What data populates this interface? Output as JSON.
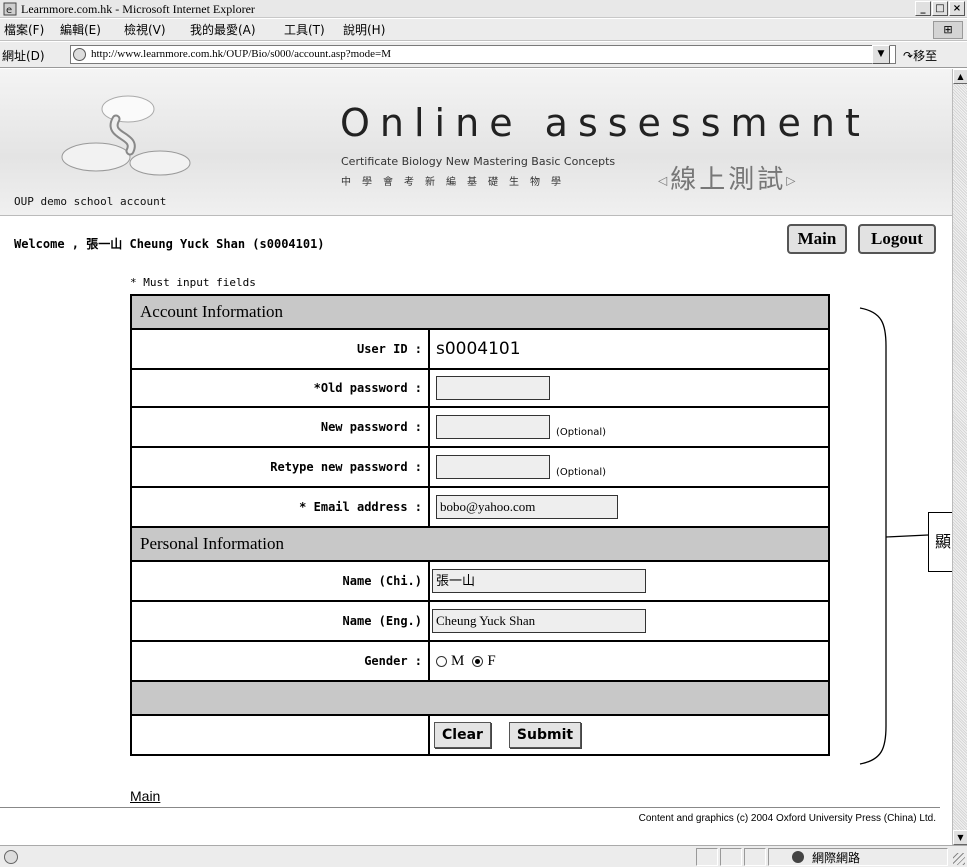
{
  "window": {
    "title": "Learnmore.com.hk - Microsoft Internet Explorer",
    "buttons": [
      "_",
      "□",
      "×"
    ]
  },
  "menubar": {
    "items": [
      "檔案(F)",
      "編輯(E)",
      "檢視(V)",
      "我的最愛(A)",
      "工具(T)",
      "說明(H)"
    ]
  },
  "addressbar": {
    "label": "網址(D)",
    "url": "http://www.learnmore.com.hk/OUP/Bio/s000/account.asp?mode=M",
    "go_label": "移至"
  },
  "banner": {
    "school_account": "OUP demo school account",
    "title": "Online assessment",
    "subtitle": "Certificate Biology New Mastering Basic Concepts",
    "chinese_title": "中學會考新編基礎生物學",
    "online_chinese": "線上測試"
  },
  "header": {
    "welcome": "Welcome , 張一山 Cheung Yuck Shan (s0004101)",
    "main_button": "Main",
    "logout_button": "Logout"
  },
  "form": {
    "must_input": "* Must input fields",
    "account_section": "Account Information",
    "personal_section": "Personal Information",
    "fields": {
      "user_id_label": "User ID :",
      "user_id_value": "s0004101",
      "old_password_label": "*Old password :",
      "new_password_label": "New password :",
      "retype_password_label": "Retype new password :",
      "email_label": "* Email address :",
      "email_value": "bobo@yahoo.com",
      "name_chi_label": "Name (Chi.)",
      "name_chi_value": "張一山",
      "name_eng_label": "Name (Eng.)",
      "name_eng_value": "Cheung Yuck Shan",
      "gender_label": "Gender :",
      "gender_m": "M",
      "gender_f": "F",
      "optional_hint": "(Optional)"
    },
    "clear_button": "Clear",
    "submit_button": "Submit"
  },
  "callout": {
    "text": "顯"
  },
  "footer": {
    "main_link": "Main",
    "copyright": "Content and graphics (c) 2004 Oxford University Press (China) Ltd."
  },
  "statusbar": {
    "zone": "網際網路"
  }
}
